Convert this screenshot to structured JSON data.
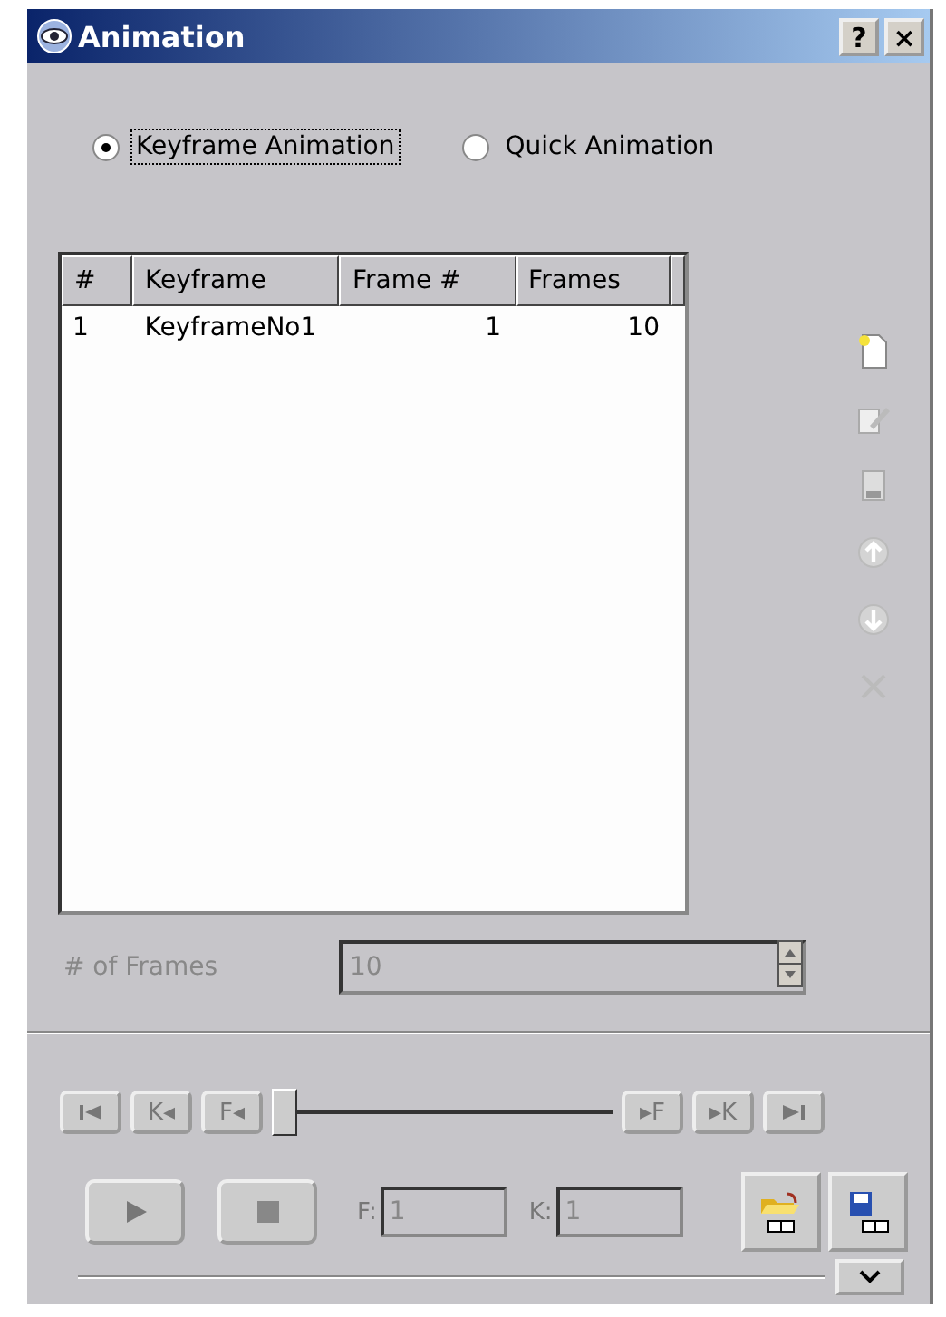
{
  "window": {
    "title": "Animation",
    "help": "?",
    "close": "×"
  },
  "modes": [
    {
      "label": "Keyframe Animation",
      "selected": true
    },
    {
      "label": "Quick Animation",
      "selected": false
    }
  ],
  "table": {
    "columns": [
      "#",
      "Keyframe",
      "Frame #",
      "Frames"
    ],
    "rows": [
      [
        "1",
        "KeyframeNo1",
        "1",
        "10"
      ]
    ]
  },
  "tools": [
    {
      "kind": "new",
      "disabled": false
    },
    {
      "kind": "edit",
      "disabled": true
    },
    {
      "kind": "save",
      "disabled": true
    },
    {
      "kind": "up",
      "disabled": true
    },
    {
      "kind": "down",
      "disabled": true
    },
    {
      "kind": "delete",
      "disabled": true
    }
  ],
  "frames": {
    "label": "# of Frames",
    "value": "10",
    "disabled": true
  },
  "nav": {
    "left": [
      {
        "kind": "first"
      },
      {
        "kind": "text",
        "label": "K◂"
      },
      {
        "kind": "text",
        "label": "F◂"
      }
    ],
    "slider": {
      "level": 0
    },
    "right": [
      {
        "kind": "text",
        "label": "▸F"
      },
      {
        "kind": "text",
        "label": "▸K"
      },
      {
        "kind": "last"
      }
    ]
  },
  "playback": {
    "frame_label": "F:",
    "frame_value": "1",
    "key_label": "K:",
    "key_value": "1"
  }
}
